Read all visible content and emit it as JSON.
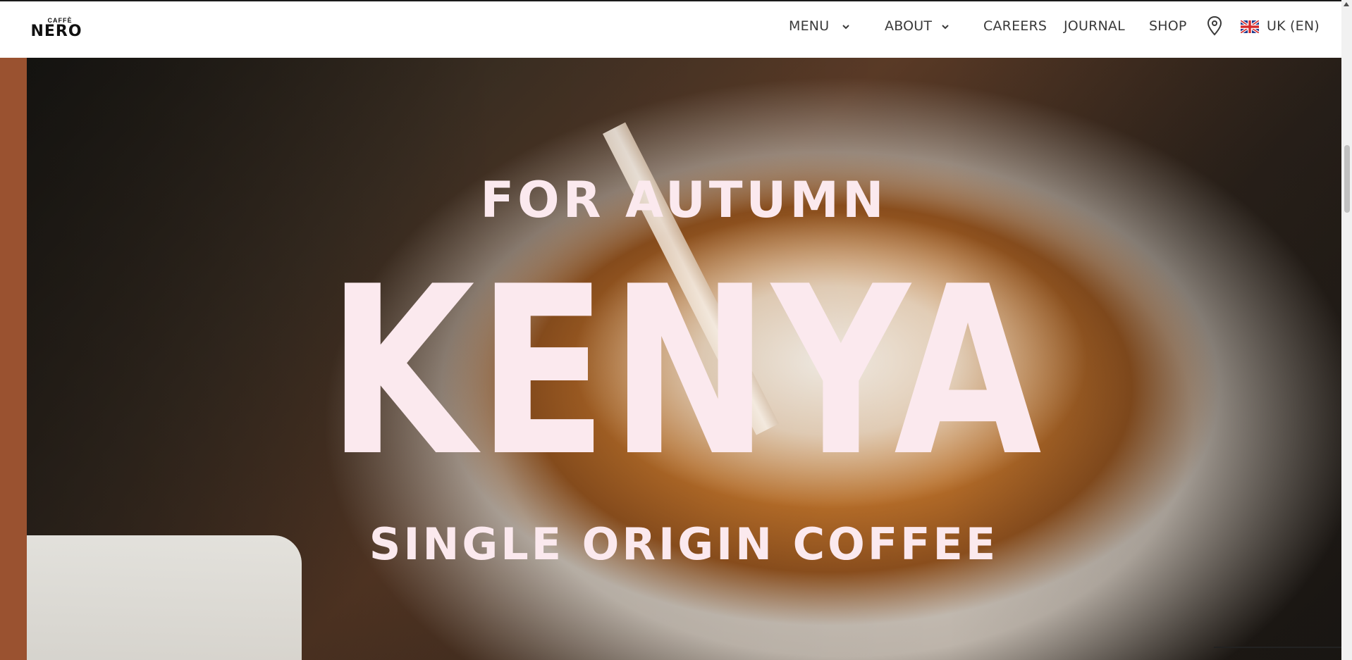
{
  "brand": {
    "logo_small": "CAFFÈ",
    "logo_big": "NERO"
  },
  "nav": {
    "menu": "MENU",
    "about": "ABOUT",
    "careers": "CAREERS",
    "journal": "JOURNAL",
    "shop": "SHOP",
    "region": "UK (EN)"
  },
  "icons": {
    "menu_chevron": "chevron-down-icon",
    "about_chevron": "chevron-down-icon",
    "location": "location-pin-icon",
    "flag": "uk-flag-icon"
  },
  "hero": {
    "eyebrow": "FOR AUTUMN",
    "headline": "KENYA",
    "subheadline": "SINGLE ORIGIN COFFEE"
  },
  "colors": {
    "hero_text": "#fbe9ee",
    "nav_text": "#3a3a3a",
    "left_strip": "#9a5230"
  }
}
